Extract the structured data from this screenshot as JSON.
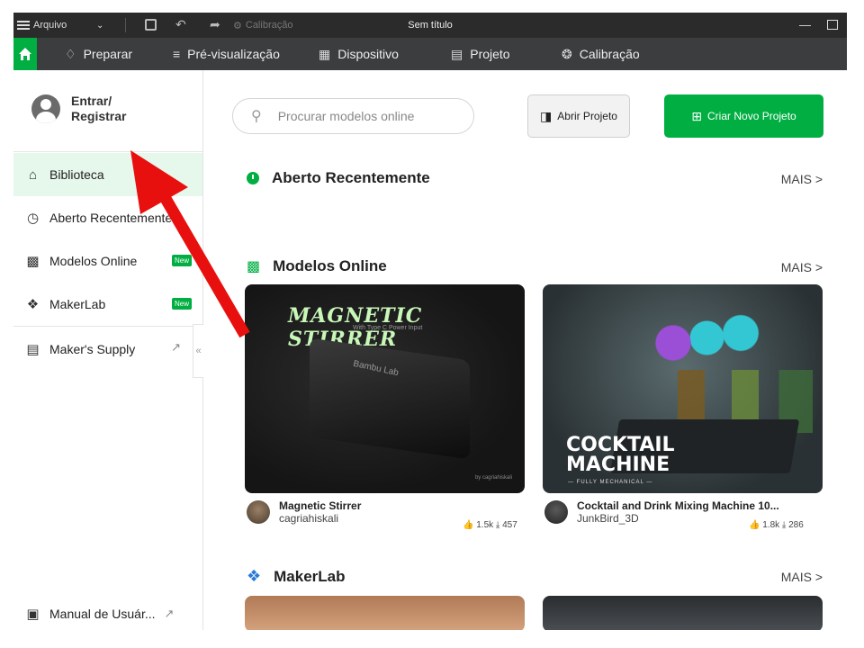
{
  "titlebar": {
    "menu_label": "Arquivo",
    "calibration_label": "Calibração",
    "window_title": "Sem título"
  },
  "navbar": {
    "items": [
      {
        "label": "Preparar",
        "icon": "prepare-icon"
      },
      {
        "label": "Pré-visualização",
        "icon": "layers-icon"
      },
      {
        "label": "Dispositivo",
        "icon": "device-icon"
      },
      {
        "label": "Projeto",
        "icon": "project-icon"
      },
      {
        "label": "Calibração",
        "icon": "calibration-icon"
      }
    ],
    "accent": "#00ae42"
  },
  "sidebar": {
    "login_label": "Entrar/ Registrar",
    "items": [
      {
        "label": "Biblioteca",
        "icon": "home-outline-icon",
        "active": true
      },
      {
        "label": "Aberto Recentemente",
        "icon": "clock-icon"
      },
      {
        "label": "Modelos Online",
        "icon": "models-icon",
        "badge": "New"
      },
      {
        "label": "MakerLab",
        "icon": "makerlab-icon",
        "badge": "New"
      },
      {
        "label": "Maker's Supply",
        "icon": "bag-icon",
        "external": true
      }
    ],
    "manual_label": "Manual de Usuár..."
  },
  "main": {
    "search_placeholder": "Procurar modelos online",
    "open_project_label": "Abrir Projeto",
    "new_project_label": "Criar Novo Projeto",
    "sections": {
      "recent": {
        "title": "Aberto Recentemente",
        "more": "MAIS >"
      },
      "online": {
        "title": "Modelos Online",
        "more": "MAIS >"
      },
      "makerlab": {
        "title": "MakerLab",
        "more": "MAIS >"
      }
    },
    "models": [
      {
        "image_title": "MAGNETIC STIRRER",
        "image_subtitle": "With Type C Power Input",
        "image_byline": "by cagriahiskali",
        "image_logo": "Bambu Lab",
        "title": "Magnetic Stirrer",
        "author": "cagriahiskali",
        "likes": "1.5k",
        "downloads": "457"
      },
      {
        "image_title": "COCKTAIL MACHINE",
        "image_subtitle": "— FULLY MECHANICAL —",
        "title": "Cocktail and Drink Mixing Machine 10...",
        "author": "JunkBird_3D",
        "likes": "1.8k",
        "downloads": "286"
      }
    ]
  },
  "annotation": {
    "color": "#e8100e"
  }
}
